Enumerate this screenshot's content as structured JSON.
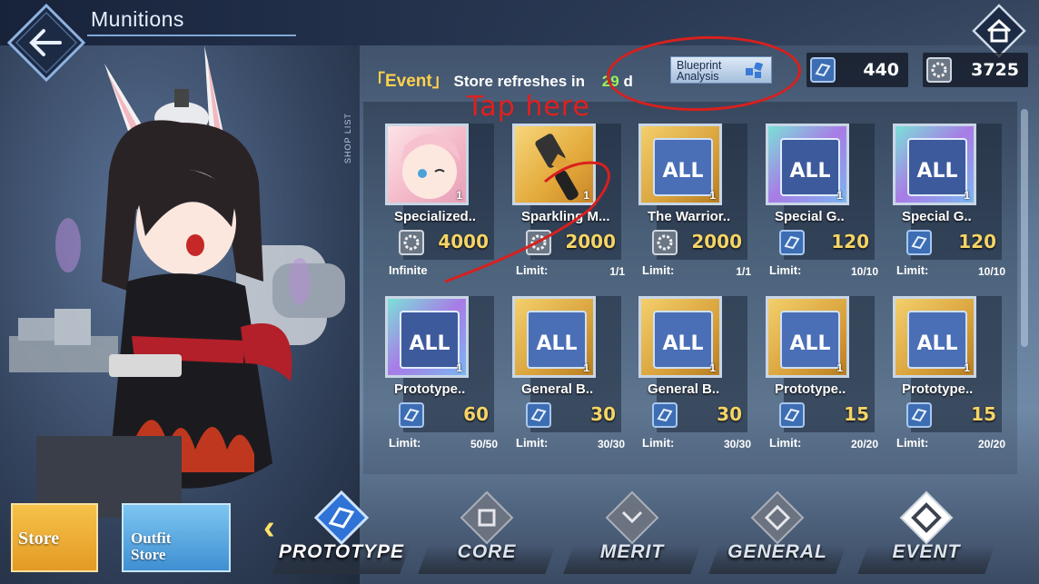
{
  "header": {
    "title": "Munitions"
  },
  "currencies": [
    {
      "icon": "prototype-core-icon",
      "value": "440"
    },
    {
      "icon": "gear-coin-icon",
      "value": "3725"
    }
  ],
  "event": {
    "tag": "「Event」",
    "refresh_text": "Store refreshes in",
    "refresh_number": "29",
    "refresh_unit": "d",
    "blueprint_button": "Blueprint Analysis",
    "blueprint_line1": "Blueprint",
    "blueprint_line2": "Analysis"
  },
  "annotation": {
    "tap_here": "Tap here"
  },
  "side_tag": "SHOP LIST",
  "items": [
    {
      "name": "Specialized..",
      "price": "4000",
      "limit_label": "Infinite",
      "limit_value": "",
      "qty": "1",
      "thumb": "bg-pink",
      "cost_icon": "gear-coin-icon"
    },
    {
      "name": "Sparkling M...",
      "price": "2000",
      "limit_label": "Limit:",
      "limit_value": "1/1",
      "qty": "1",
      "thumb": "bg-gold",
      "cost_icon": "gear-coin-icon"
    },
    {
      "name": "The Warrior..",
      "price": "2000",
      "limit_label": "Limit:",
      "limit_value": "1/1",
      "qty": "1",
      "thumb": "bg-gold2",
      "cost_icon": "gear-coin-icon"
    },
    {
      "name": "Special G..",
      "price": "120",
      "limit_label": "Limit:",
      "limit_value": "10/10",
      "qty": "1",
      "thumb": "bg-rainbow",
      "cost_icon": "prototype-core-icon"
    },
    {
      "name": "Special G..",
      "price": "120",
      "limit_label": "Limit:",
      "limit_value": "10/10",
      "qty": "1",
      "thumb": "bg-rainbow",
      "cost_icon": "prototype-core-icon"
    },
    {
      "name": "Prototype..",
      "price": "60",
      "limit_label": "Limit:",
      "limit_value": "50/50",
      "qty": "1",
      "thumb": "bg-rainbow",
      "cost_icon": "prototype-core-icon"
    },
    {
      "name": "General B..",
      "price": "30",
      "limit_label": "Limit:",
      "limit_value": "30/30",
      "qty": "1",
      "thumb": "bg-gold2",
      "cost_icon": "prototype-core-icon"
    },
    {
      "name": "General B..",
      "price": "30",
      "limit_label": "Limit:",
      "limit_value": "30/30",
      "qty": "1",
      "thumb": "bg-gold2",
      "cost_icon": "prototype-core-icon"
    },
    {
      "name": "Prototype..",
      "price": "15",
      "limit_label": "Limit:",
      "limit_value": "20/20",
      "qty": "1",
      "thumb": "bg-gold2",
      "cost_icon": "prototype-core-icon"
    },
    {
      "name": "Prototype..",
      "price": "15",
      "limit_label": "Limit:",
      "limit_value": "20/20",
      "qty": "1",
      "thumb": "bg-gold2",
      "cost_icon": "prototype-core-icon"
    }
  ],
  "bottom_nav": {
    "store": "Store",
    "outfit_line1": "Outfit",
    "outfit_line2": "Store",
    "tabs": [
      {
        "label": "PROTOTYPE",
        "active": true
      },
      {
        "label": "CORE",
        "active": false
      },
      {
        "label": "MERIT",
        "active": false
      },
      {
        "label": "GENERAL",
        "active": false
      },
      {
        "label": "EVENT",
        "active": false
      }
    ]
  },
  "colors": {
    "accent_gold": "#f5d466",
    "annotation_red": "#d8201e",
    "limit_green": "#9cf05a"
  }
}
